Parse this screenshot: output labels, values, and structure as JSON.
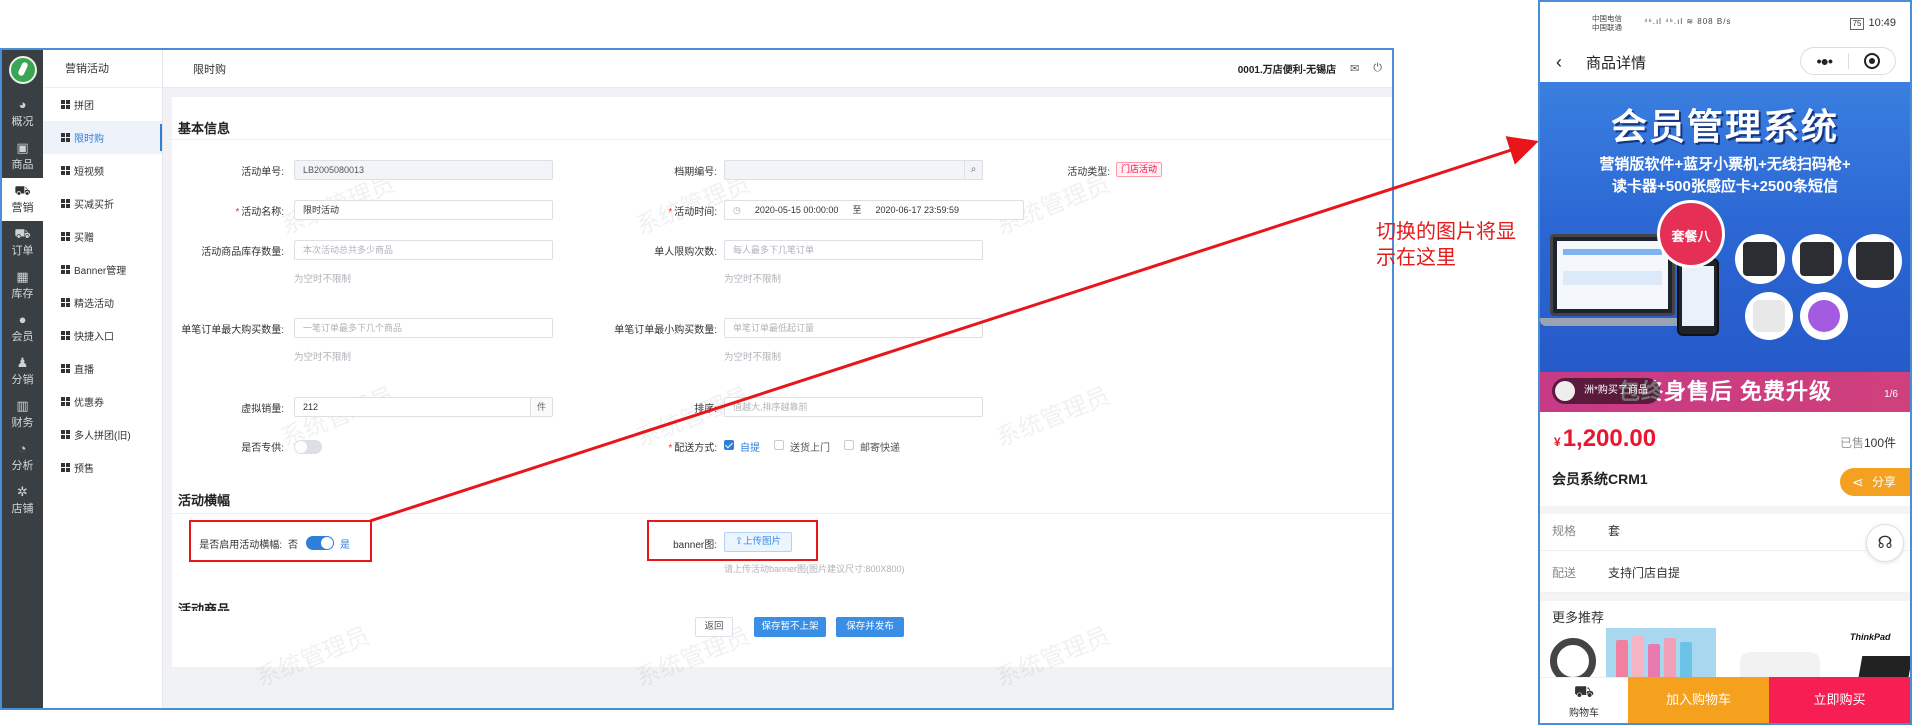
{
  "admin": {
    "rail": [
      {
        "label": "概况",
        "icon": "dashboard-icon"
      },
      {
        "label": "商品",
        "icon": "goods-icon"
      },
      {
        "label": "营销",
        "icon": "marketing-icon"
      },
      {
        "label": "订单",
        "icon": "cart-icon"
      },
      {
        "label": "库存",
        "icon": "stock-icon"
      },
      {
        "label": "会员",
        "icon": "member-icon"
      },
      {
        "label": "分销",
        "icon": "distribution-icon"
      },
      {
        "label": "财务",
        "icon": "finance-icon"
      },
      {
        "label": "分析",
        "icon": "analysis-icon"
      },
      {
        "label": "店铺",
        "icon": "gear-icon"
      }
    ],
    "subnav_title": "营销活动",
    "subnav": [
      "拼团",
      "限时购",
      "短视频",
      "买减买折",
      "买赠",
      "Banner管理",
      "精选活动",
      "快捷入口",
      "直播",
      "优惠券",
      "多人拼团(旧)",
      "预售"
    ],
    "topbar": {
      "title": "限时购",
      "store": "0001.万店便利-无锡店"
    },
    "form": {
      "section_basic": "基本信息",
      "activity_no_label": "活动单号:",
      "activity_no_value": "LB2005080013",
      "period_label": "档期编号:",
      "type_label": "活动类型:",
      "type_value": "门店活动",
      "name_label": "活动名称:",
      "name_value": "限时活动",
      "time_label": "活动时间:",
      "time_start": "2020-05-15 00:00:00",
      "time_to": "至",
      "time_end": "2020-06-17 23:59:59",
      "stock_label": "活动商品库存数量:",
      "stock_placeholder": "本次活动总共多少商品",
      "empty_hint": "为空时不限制",
      "limit_label": "单人限购次数:",
      "limit_placeholder": "每人最多下几笔订单",
      "max_label": "单笔订单最大购买数量:",
      "max_placeholder": "一笔订单最多下几个商品",
      "min_label": "单笔订单最小购买数量:",
      "min_placeholder": "单笔订单最低起订量",
      "virtual_label": "虚拟销量:",
      "virtual_value": "212",
      "virtual_unit": "件",
      "sort_label": "排序:",
      "sort_placeholder": "值越大,排序越靠前",
      "exclusive_label": "是否专供:",
      "delivery_label": "配送方式:",
      "delivery_options": [
        "自提",
        "送货上门",
        "邮寄快递"
      ],
      "section_banner": "活动横幅",
      "banner_enable_label": "是否启用活动横幅:",
      "banner_off": "否",
      "banner_on": "是",
      "banner_img_label": "banner图:",
      "upload_label": "上传图片",
      "upload_hint": "请上传活动banner图(图片建议尺寸:800X800)",
      "section_goods": "活动商品",
      "btn_back": "返回",
      "btn_save_off": "保存暂不上架",
      "btn_save_publish": "保存并发布",
      "watermark": "系统管理员"
    }
  },
  "annotation": "切换的图片将显示在这里",
  "phone": {
    "carrier1": "中国电信",
    "carrier2": "中国联通",
    "speed": "808 B/s",
    "battery": "75",
    "time": "10:49",
    "nav_title": "商品详情",
    "banner_title": "会员管理系统",
    "banner_sub1": "营销版软件+蓝牙小票机+无线扫码枪+",
    "banner_sub2": "读卡器+500张感应卡+2500条短信",
    "banner_badge": "套餐八",
    "banner_foot": "包终身售后 免费升级",
    "buy_toast": "洲*购买了商品",
    "page_indicator": "1/6",
    "price_symbol": "¥",
    "price": "1,200.00",
    "sold_prefix": "已售",
    "sold_count": "100件",
    "product_name": "会员系统CRM1",
    "share": "分享",
    "spec_label": "规格",
    "spec_value": "套",
    "delivery_label": "配送",
    "delivery_value": "支持门店自提",
    "more_reco": "更多推荐",
    "reco_brand": "ThinkPad",
    "cart": "购物车",
    "add_cart": "加入购物车",
    "buy_now": "立即购买"
  },
  "colors": {
    "accent": "#2f7fd8",
    "annotation_red": "#e8161a",
    "price_red": "#e8162e",
    "add_cart_orange": "#f6a11d",
    "buy_now_pink": "#f61e52"
  }
}
